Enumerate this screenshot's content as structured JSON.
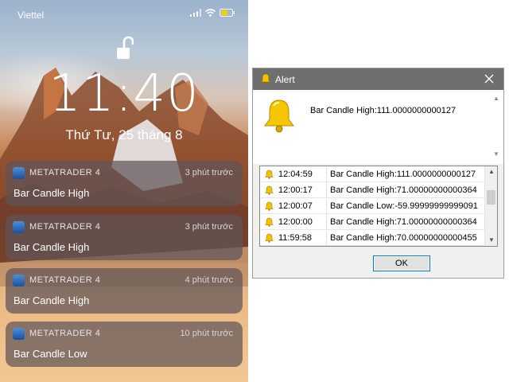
{
  "phone": {
    "carrier": "Viettel",
    "clock": "11:40",
    "date": "Thứ Tư, 25 tháng 8",
    "notifications": [
      {
        "app": "METATRADER 4",
        "time": "3 phút trước",
        "title": "Bar Candle High"
      },
      {
        "app": "METATRADER 4",
        "time": "3 phút trước",
        "title": "Bar Candle High"
      },
      {
        "app": "METATRADER 4",
        "time": "4 phút trước",
        "title": "Bar Candle High"
      },
      {
        "app": "METATRADER 4",
        "time": "10 phút trước",
        "title": "Bar Candle Low"
      }
    ],
    "icons": [
      "signal-icon",
      "wifi-icon",
      "battery-icon",
      "unlock-icon"
    ]
  },
  "alert": {
    "title": "Alert",
    "message": "Bar Candle High:111.0000000000127",
    "ok_label": "OK",
    "rows": [
      {
        "time": "12:04:59",
        "message": "Bar Candle High:111.0000000000127"
      },
      {
        "time": "12:00:17",
        "message": "Bar Candle High:71.00000000000364"
      },
      {
        "time": "12:00:07",
        "message": "Bar Candle Low:-59.99999999999091"
      },
      {
        "time": "12:00:00",
        "message": "Bar Candle High:71.00000000000364"
      },
      {
        "time": "11:59:58",
        "message": "Bar Candle High:70.00000000000455"
      }
    ],
    "colors": {
      "titlebar": "#6f6f6f",
      "ok_border": "#0078d7",
      "bell": "#f2c200"
    }
  }
}
